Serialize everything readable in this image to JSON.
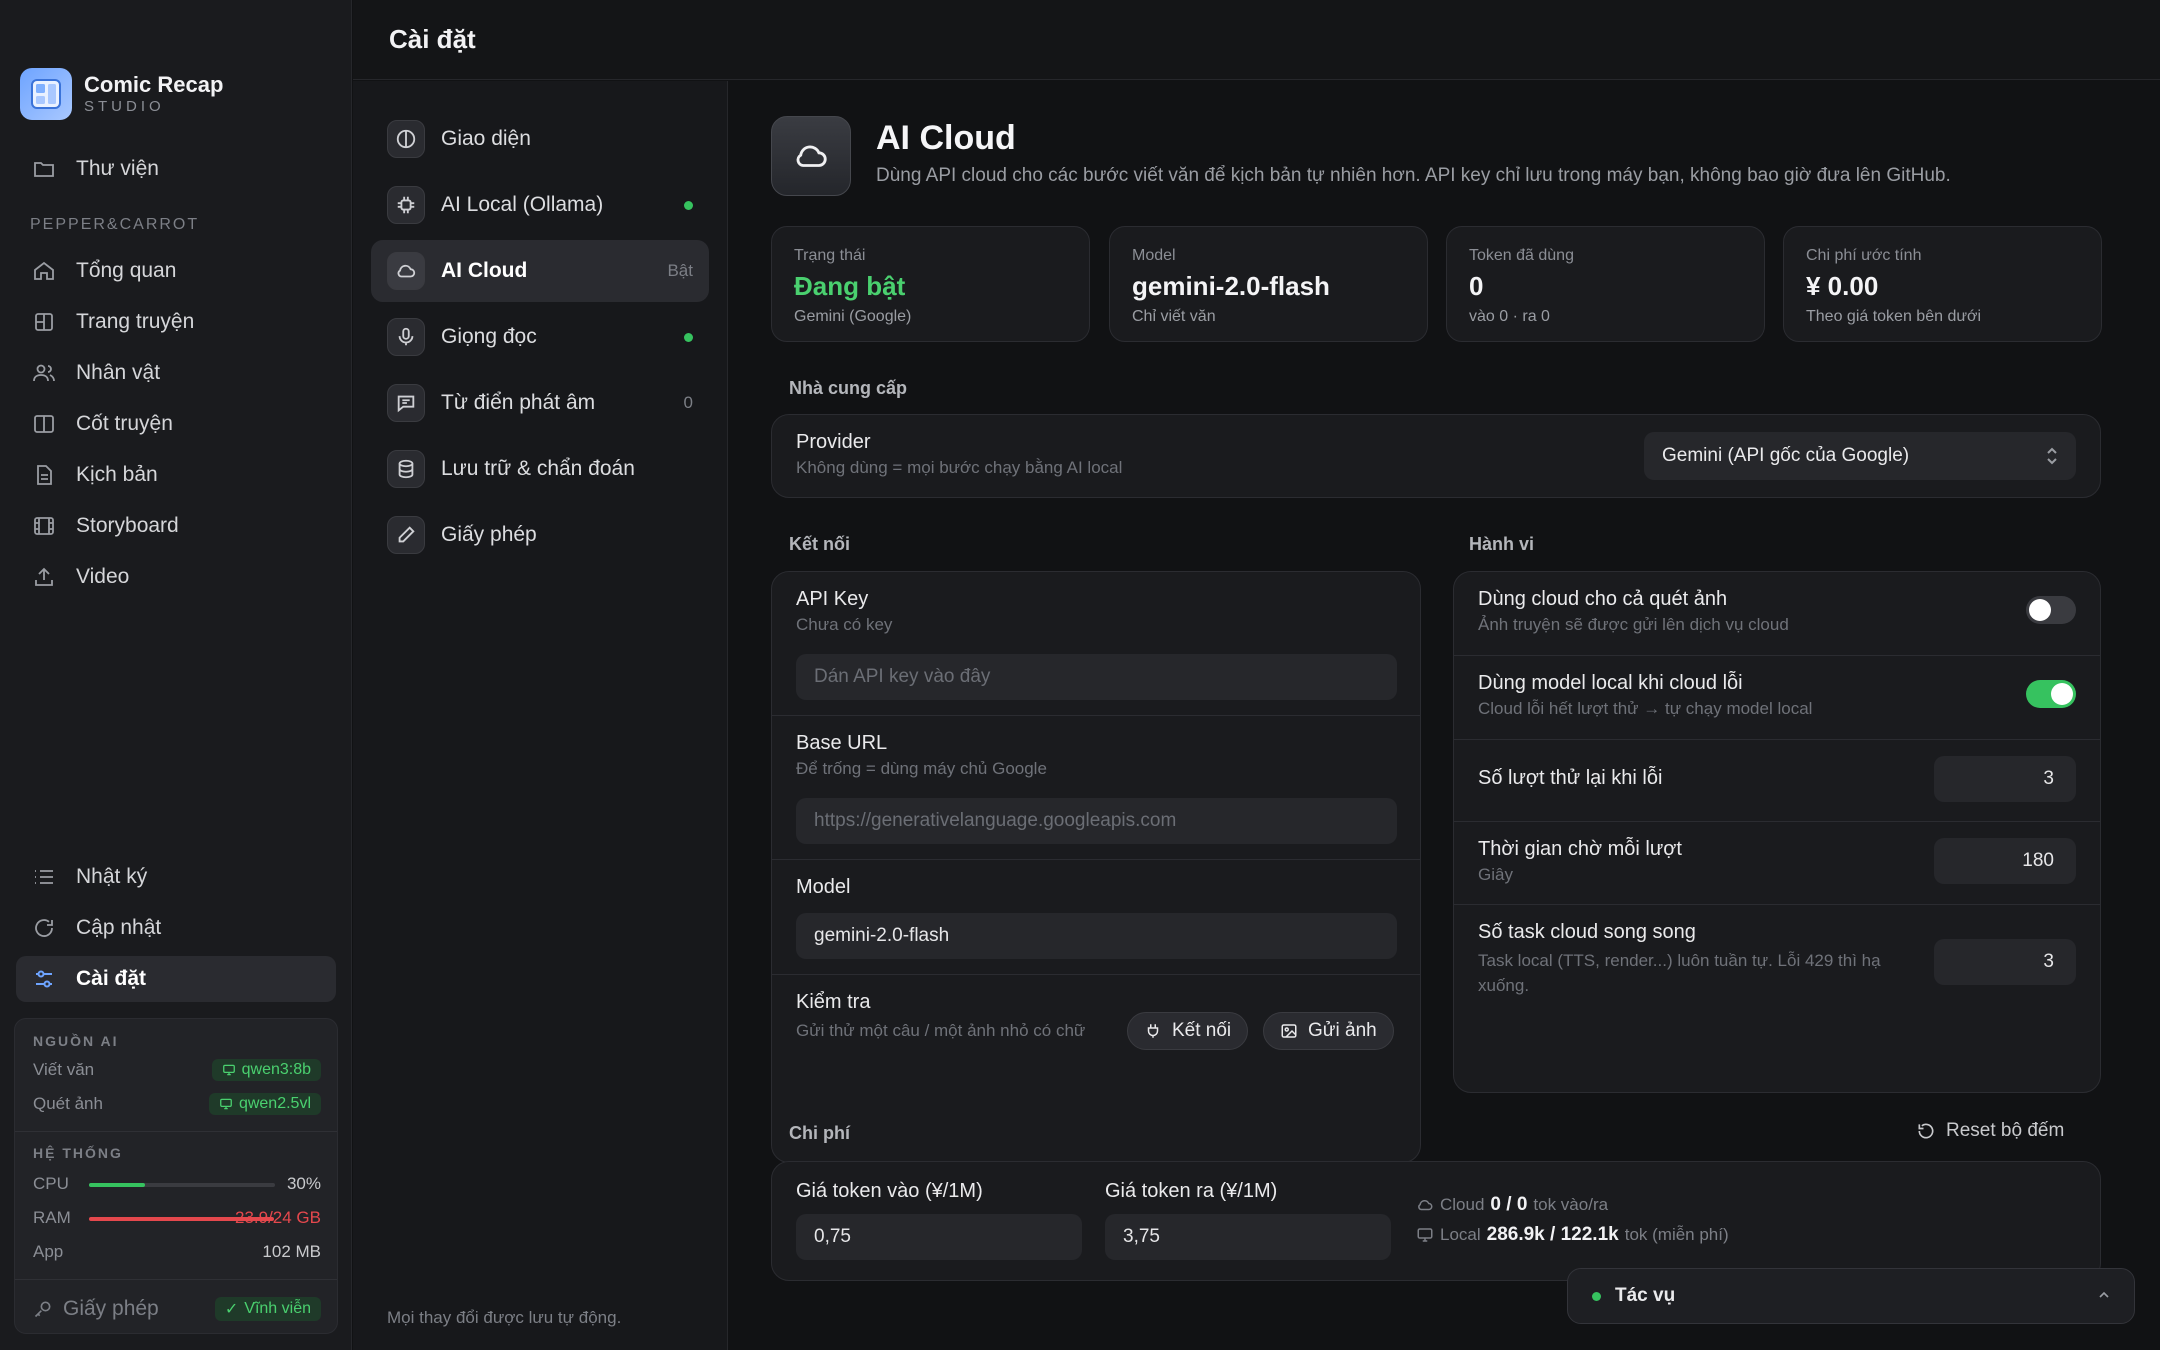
{
  "brand": {
    "name": "Comic Recap",
    "sub": "STUDIO"
  },
  "sidebar": {
    "library": "Thư viện",
    "project_section": "PEPPER&CARROT",
    "items": [
      "Tổng quan",
      "Trang truyện",
      "Nhân vật",
      "Cốt truyện",
      "Kịch bản",
      "Storyboard",
      "Video"
    ],
    "bottom_items": [
      "Nhật ký",
      "Cập nhật",
      "Cài đặt"
    ],
    "ai_source": {
      "heading": "NGUỒN AI",
      "rows": [
        {
          "label": "Viết văn",
          "value": "qwen3:8b"
        },
        {
          "label": "Quét ảnh",
          "value": "qwen2.5vl"
        }
      ]
    },
    "system": {
      "heading": "HỆ THỐNG",
      "cpu_label": "CPU",
      "cpu_value": "30%",
      "cpu_fraction": 0.3,
      "ram_label": "RAM",
      "ram_value": "23.9/24 GB",
      "ram_fraction": 0.996,
      "app_label": "App",
      "app_value": "102 MB"
    },
    "license": {
      "label": "Giấy phép",
      "value": "Vĩnh viễn"
    }
  },
  "header": {
    "title": "Cài đặt"
  },
  "settings_menu": {
    "items": [
      {
        "label": "Giao diện",
        "right": ""
      },
      {
        "label": "AI Local (Ollama)",
        "right": ""
      },
      {
        "label": "AI Cloud",
        "right": "Bật"
      },
      {
        "label": "Giọng đọc",
        "right": ""
      },
      {
        "label": "Từ điển phát âm",
        "right": "0"
      },
      {
        "label": "Lưu trữ & chẩn đoán",
        "right": ""
      },
      {
        "label": "Giấy phép",
        "right": ""
      }
    ],
    "footer": "Mọi thay đổi được lưu tự động."
  },
  "page": {
    "title": "AI Cloud",
    "description": "Dùng API cloud cho các bước viết văn để kịch bản tự nhiên hơn. API key chỉ lưu trong máy bạn, không bao giờ đưa lên GitHub.",
    "stats": [
      {
        "label": "Trạng thái",
        "value": "Đang bật",
        "sub": "Gemini (Google)"
      },
      {
        "label": "Model",
        "value": "gemini-2.0-flash",
        "sub": "Chỉ viết văn"
      },
      {
        "label": "Token đã dùng",
        "value": "0",
        "sub": "vào 0 · ra 0"
      },
      {
        "label": "Chi phí ước tính",
        "value": "¥ 0.00",
        "sub": "Theo giá token bên dưới"
      }
    ],
    "provider_section": "Nhà cung cấp",
    "provider": {
      "title": "Provider",
      "sub": "Không dùng = mọi bước chạy bằng AI local",
      "selected": "Gemini (API gốc của Google)"
    },
    "connection_section": "Kết nối",
    "api_key": {
      "title": "API Key",
      "sub": "Chưa có key",
      "placeholder": "Dán API key vào đây"
    },
    "base_url": {
      "title": "Base URL",
      "sub": "Để trống = dùng máy chủ Google",
      "placeholder": "https://generativelanguage.googleapis.com"
    },
    "model": {
      "title": "Model",
      "value": "gemini-2.0-flash"
    },
    "test": {
      "title": "Kiểm tra",
      "sub": "Gửi thử một câu / một ảnh nhỏ có chữ",
      "connect_label": "Kết nối",
      "send_image_label": "Gửi ảnh"
    },
    "behavior_section": "Hành vi",
    "behavior": {
      "cloud_scan": {
        "title": "Dùng cloud cho cả quét ảnh",
        "sub": "Ảnh truyện sẽ được gửi lên dịch vụ cloud",
        "on": false
      },
      "fallback": {
        "title": "Dùng model local khi cloud lỗi",
        "sub": "Cloud lỗi hết lượt thử → tự chạy model local",
        "on": true
      },
      "retries": {
        "title": "Số lượt thử lại khi lỗi",
        "value": "3"
      },
      "timeout": {
        "title": "Thời gian chờ mỗi lượt",
        "sub": "Giây",
        "value": "180"
      },
      "parallel": {
        "title": "Số task cloud song song",
        "sub": "Task local (TTS, render...) luôn tuần tự. Lỗi 429 thì hạ xuống.",
        "value": "3"
      }
    },
    "cost_section": "Chi phí",
    "reset_label": "Reset bộ đếm",
    "cost": {
      "in_label": "Giá token vào (¥/1M)",
      "in_value": "0,75",
      "out_label": "Giá token ra (¥/1M)",
      "out_value": "3,75",
      "cloud_label": "Cloud",
      "cloud_value": "0 / 0",
      "cloud_unit": "tok vào/ra",
      "local_label": "Local",
      "local_value": "286.9k / 122.1k",
      "local_unit": "tok (miễn phí)"
    }
  },
  "tasks": {
    "label": "Tác vụ"
  },
  "colors": {
    "accent": "#6ea4ff",
    "success": "#36c25f",
    "danger": "#e5484d",
    "status_on": "#4ad06f"
  }
}
